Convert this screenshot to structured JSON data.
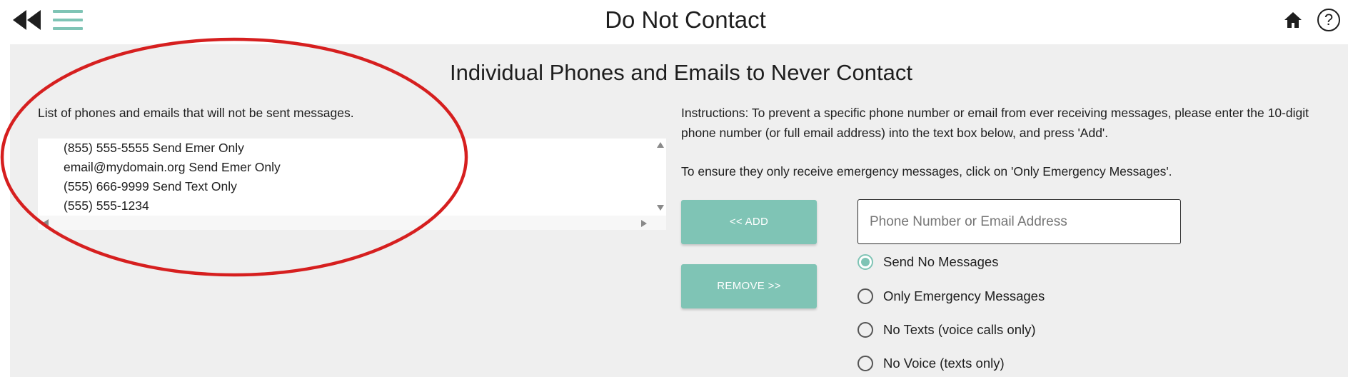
{
  "header": {
    "title": "Do Not Contact",
    "help_label": "?"
  },
  "main": {
    "heading": "Individual Phones and Emails to Never Contact",
    "list_caption": "List of phones and emails that will not be sent messages.",
    "list_items": [
      "(855) 555-5555 Send Emer Only",
      "email@mydomain.org Send Emer Only",
      "(555) 666-9999 Send Text Only",
      "(555) 555-1234"
    ],
    "instructions": "Instructions: To prevent a specific phone number or email from ever receiving messages, please enter the 10-digit phone number (or full email address) into the text box below, and press 'Add'.",
    "instructions_emergency": "To ensure they only receive emergency messages, click on 'Only Emergency Messages'.",
    "add_label": "<< ADD",
    "remove_label": "REMOVE >>",
    "entry_placeholder": "Phone Number or Email Address",
    "options": [
      {
        "label": "Send No Messages",
        "checked": true
      },
      {
        "label": "Only Emergency Messages",
        "checked": false
      },
      {
        "label": "No Texts (voice calls only)",
        "checked": false
      },
      {
        "label": "No Voice (texts only)",
        "checked": false
      }
    ]
  },
  "colors": {
    "accent": "#7fc4b5",
    "background": "#efefef",
    "annotation_ellipse": "#d61f1f"
  }
}
